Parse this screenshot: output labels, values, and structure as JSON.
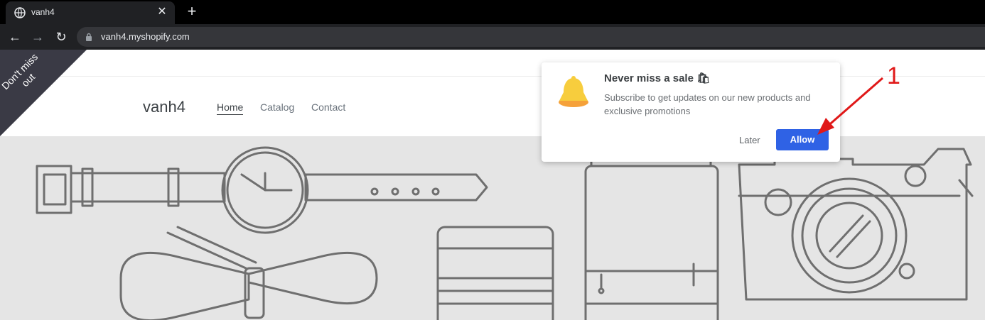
{
  "browser": {
    "tab_title": "vanh4",
    "tab_close": "✕",
    "new_tab": "+",
    "url": "vanh4.myshopify.com",
    "back": "←",
    "forward": "→",
    "reload": "↻"
  },
  "site": {
    "ribbon": "Don't miss out",
    "brand": "vanh4",
    "nav": [
      "Home",
      "Catalog",
      "Contact"
    ],
    "hero_bg": "#e5e5e5"
  },
  "popup": {
    "title": "Never miss a sale 🛍",
    "body": "Subscribe to get updates on our new products and exclusive promotions",
    "later": "Later",
    "allow": "Allow",
    "allow_color": "#2f62e5"
  },
  "annotation": {
    "number": "1",
    "color": "#e01818"
  }
}
